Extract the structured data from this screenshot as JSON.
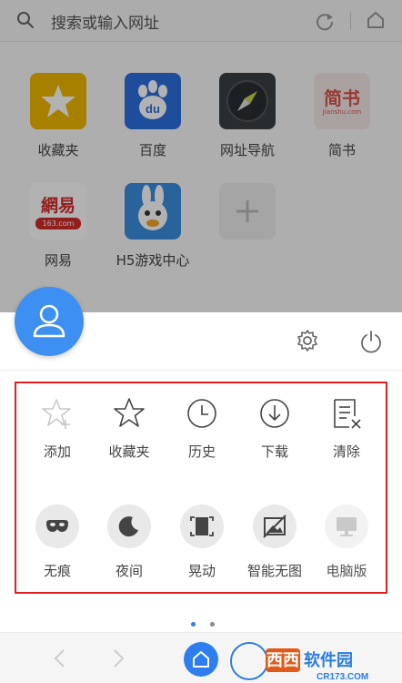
{
  "address_bar": {
    "placeholder": "搜索或输入网址"
  },
  "shortcuts": [
    {
      "label": "收藏夹",
      "icon": "star-icon",
      "color": "#f0b800"
    },
    {
      "label": "百度",
      "icon": "baidu-paw-icon",
      "color": "#2b6fe0"
    },
    {
      "label": "网址导航",
      "icon": "compass-icon",
      "color": "#3a3f44"
    },
    {
      "label": "简书",
      "icon": "jianshu-logo",
      "logo_text": "简书",
      "logo_sub": "Jianshu.com",
      "color": "#f3e9e6"
    },
    {
      "label": "网易",
      "icon": "netease-logo",
      "logo_text": "網易",
      "logo_sub": "163.com",
      "color": "#ffffff"
    },
    {
      "label": "H5游戏中心",
      "icon": "h5-game-mascot",
      "color": "#3b8fe0"
    },
    {
      "label": "",
      "icon": "add-shortcut-icon",
      "color": "#ececec"
    }
  ],
  "menu": {
    "row1": [
      {
        "label": "添加",
        "icon": "star-plus-icon"
      },
      {
        "label": "收藏夹",
        "icon": "star-outline-icon"
      },
      {
        "label": "历史",
        "icon": "clock-icon"
      },
      {
        "label": "下载",
        "icon": "download-icon"
      },
      {
        "label": "清除",
        "icon": "clear-doc-icon"
      }
    ],
    "row2": [
      {
        "label": "无痕",
        "icon": "mask-icon"
      },
      {
        "label": "夜间",
        "icon": "moon-icon"
      },
      {
        "label": "晃动",
        "icon": "shake-icon"
      },
      {
        "label": "智能无图",
        "icon": "no-image-icon"
      },
      {
        "label": "电脑版",
        "icon": "desktop-icon"
      }
    ]
  },
  "page_indicator": {
    "total": 2,
    "active": 1
  },
  "watermark": {
    "brand": "西西软件园",
    "url": "CR173.COM"
  },
  "colors": {
    "accent": "#2f7ef0",
    "highlight_border": "#e02020",
    "avatar": "#3d8ff2"
  }
}
